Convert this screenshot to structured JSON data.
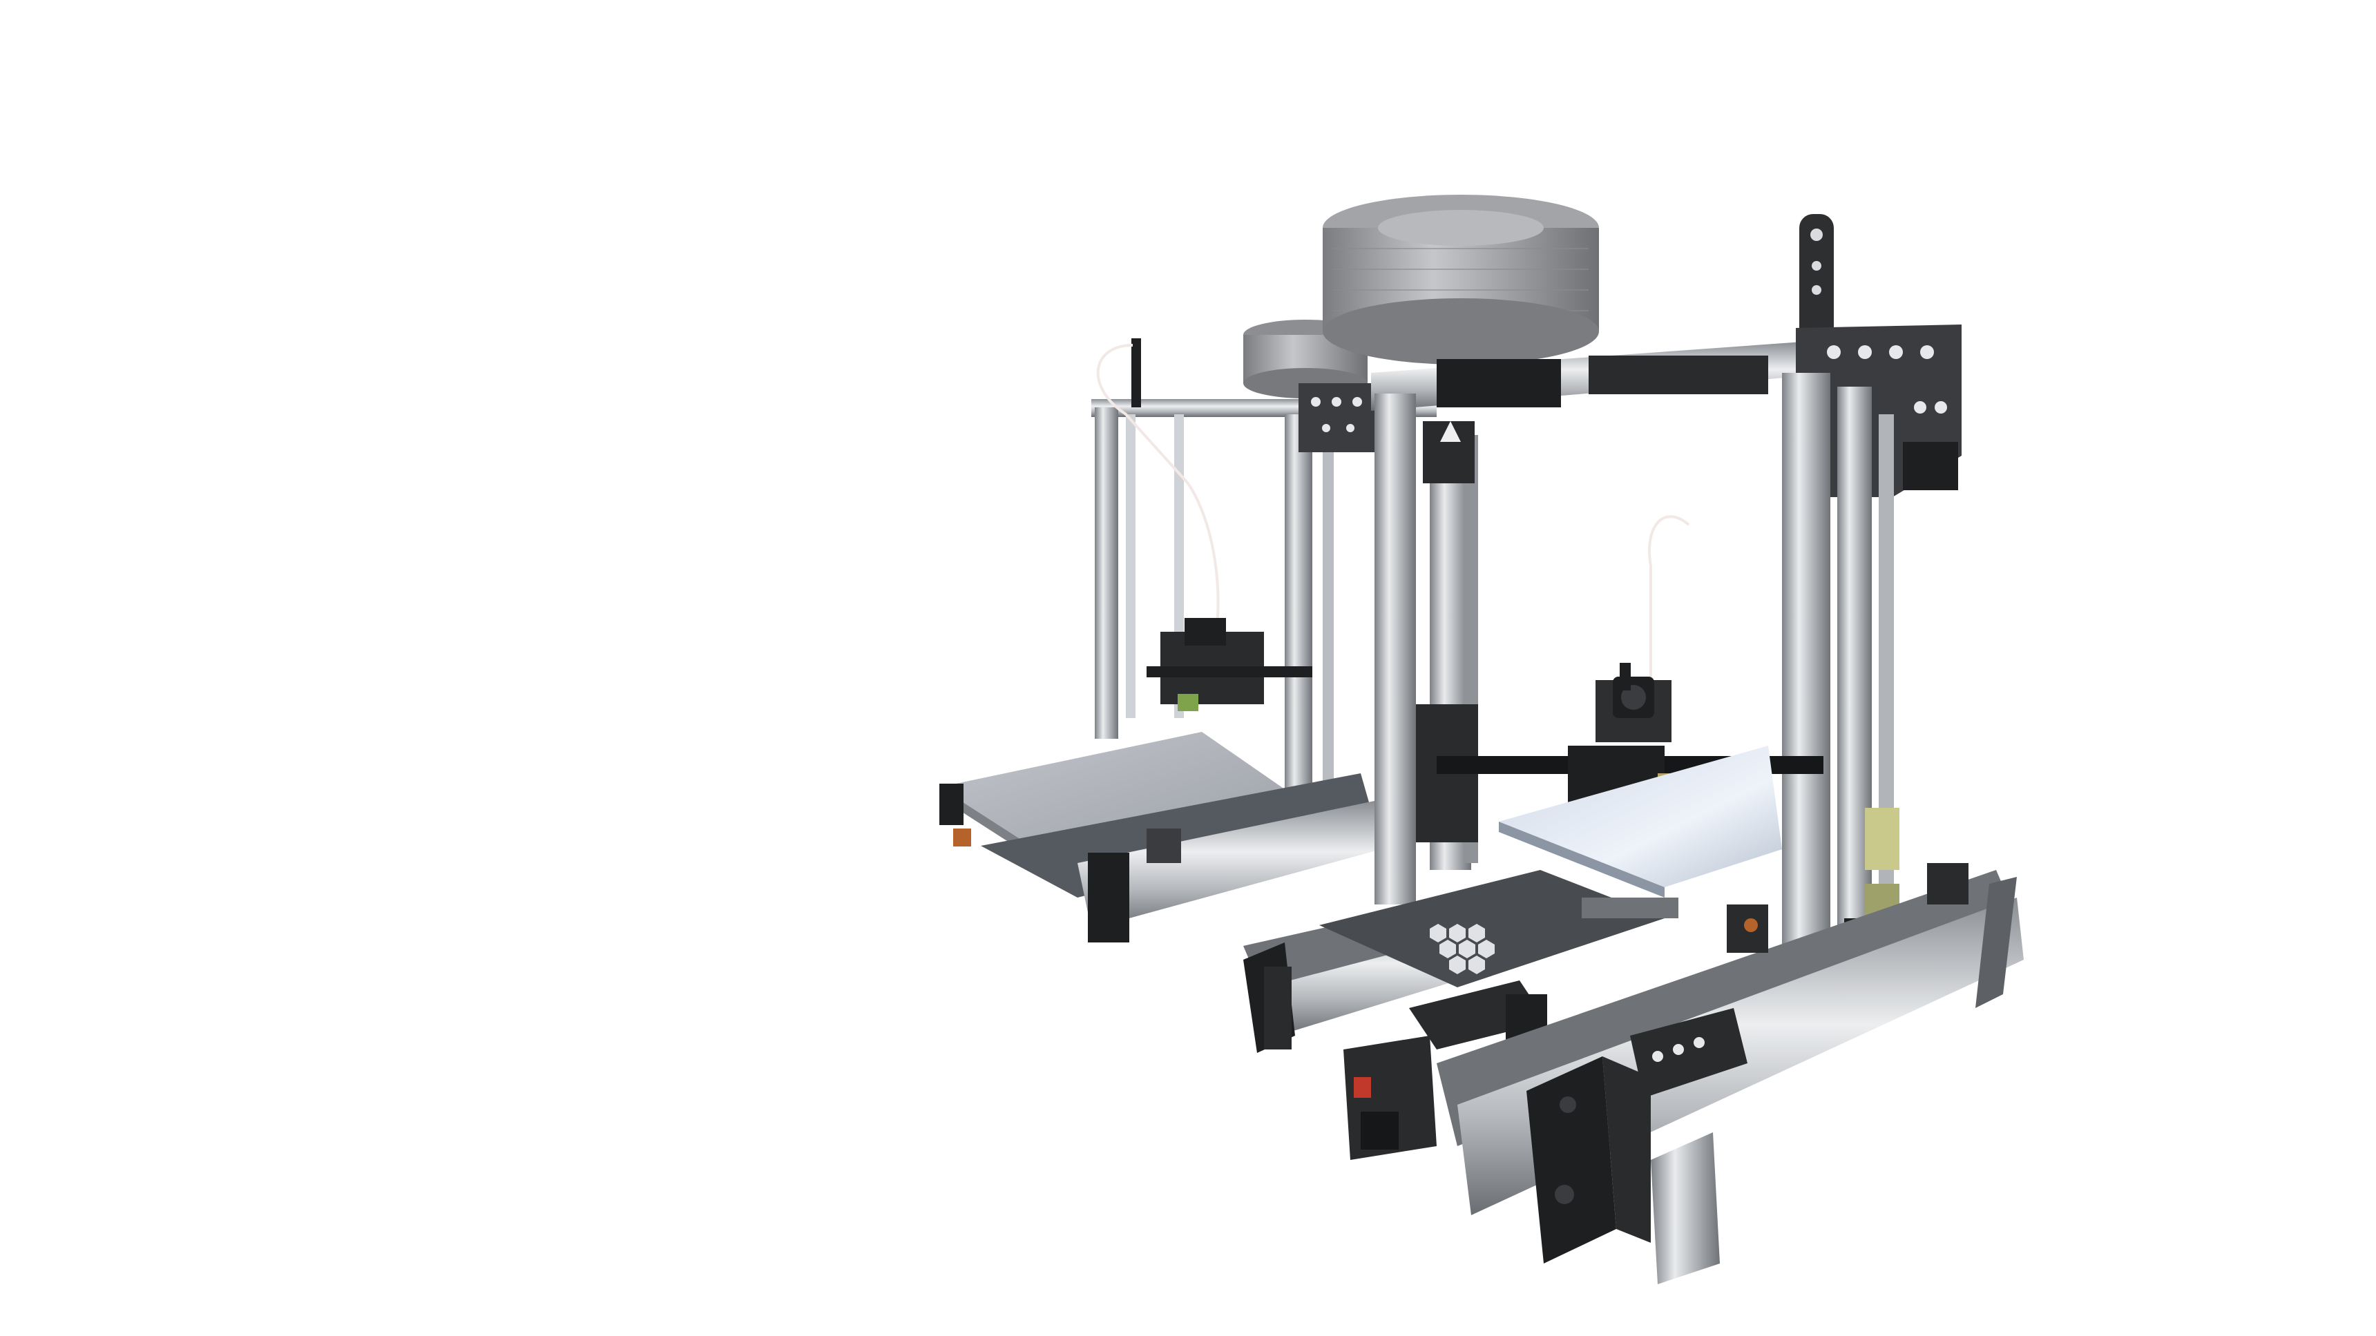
{
  "scene": {
    "description_visible_text": "",
    "background": "#ffffff",
    "colors": {
      "aluminum_light": "#e6e8ea",
      "aluminum_mid": "#b9bcc0",
      "aluminum_dark": "#7d8186",
      "black_part": "#1e1f21",
      "dark_gray_part": "#3a3c3f",
      "bed_surface": "#c9ccd2",
      "bed_surface_front": "#dfe7f2",
      "spool": "#9a9c9f",
      "spool_dark": "#6e7073",
      "filament": "#f2e9e6",
      "copper_accent": "#b5632b",
      "pcb_green": "#7fa34a",
      "red_switch": "#c0392b"
    },
    "objects": [
      {
        "name": "rear-3d-printer",
        "kind": "3d-printer-frame"
      },
      {
        "name": "front-3d-printer",
        "kind": "3d-printer-frame"
      },
      {
        "name": "rear-filament-spool",
        "kind": "spool"
      },
      {
        "name": "front-filament-spool",
        "kind": "spool"
      }
    ]
  }
}
